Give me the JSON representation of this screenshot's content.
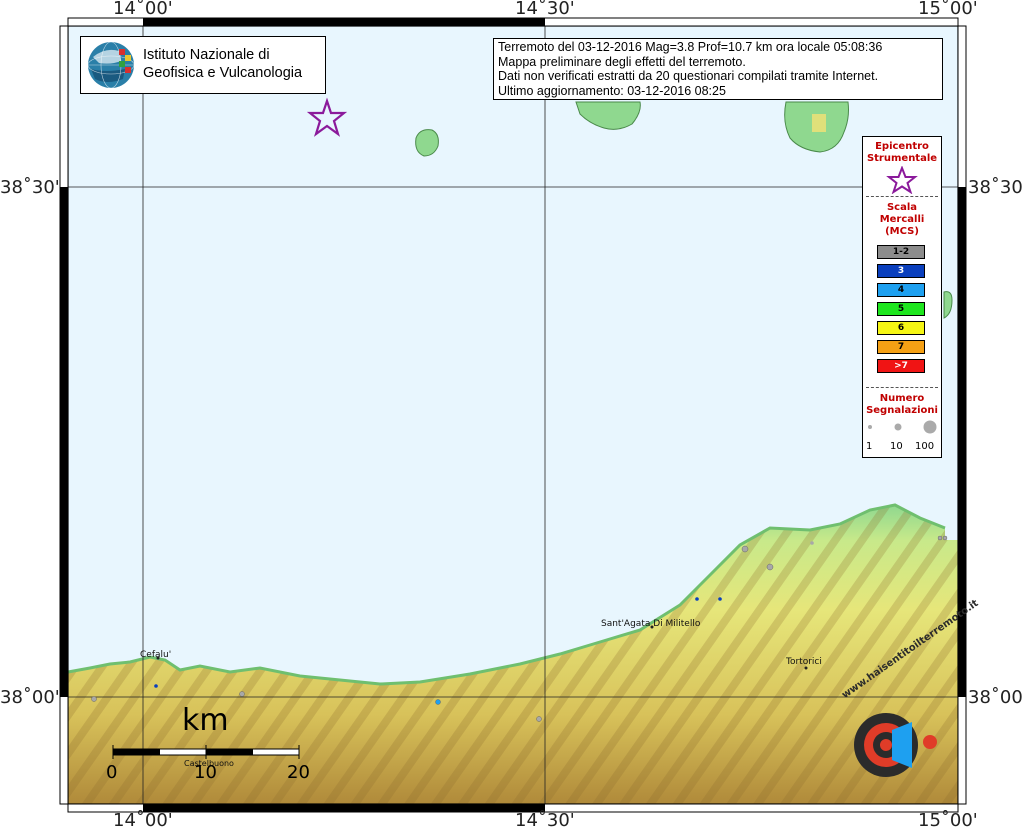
{
  "map": {
    "lon_labels": [
      "14˚00'",
      "14˚30'",
      "15˚00'"
    ],
    "lat_labels": [
      "38˚30'",
      "38˚00'"
    ],
    "colors": {
      "sea": "#e8f6fe",
      "frame": "#000000",
      "epicenter": "#8b1a9b"
    }
  },
  "institute": {
    "name_line1": "Istituto Nazionale di",
    "name_line2": "Geofisica e Vulcanologia"
  },
  "info": {
    "line1": "Terremoto del 03-12-2016 Mag=3.8 Prof=10.7 km ora locale 05:08:36",
    "line2": "Mappa preliminare degli effetti del terremoto.",
    "line3": "Dati non verificati estratti da 20 questionari compilati tramite Internet.",
    "line4": "Ultimo aggiornamento: 03-12-2016 08:25"
  },
  "legend": {
    "epicenter_title_1": "Epicentro",
    "epicenter_title_2": "Strumentale",
    "scale_title_1": "Scala",
    "scale_title_2": "Mercalli",
    "scale_title_3": "(MCS)",
    "classes": [
      {
        "label": "1-2",
        "color": "#8c8c8c",
        "text_color": "#000000"
      },
      {
        "label": "3",
        "color": "#0a3fbd",
        "text_color": "#ffffff"
      },
      {
        "label": "4",
        "color": "#1ea0f0",
        "text_color": "#000000"
      },
      {
        "label": "5",
        "color": "#1ee61e",
        "text_color": "#000000"
      },
      {
        "label": "6",
        "color": "#f5f514",
        "text_color": "#000000"
      },
      {
        "label": "7",
        "color": "#f5a014",
        "text_color": "#000000"
      },
      {
        "label": ">7",
        "color": "#f01414",
        "text_color": "#ffffff"
      }
    ],
    "count_title_1": "Numero",
    "count_title_2": "Segnalazioni",
    "count_values": [
      "1",
      "10",
      "100"
    ]
  },
  "towns": {
    "cefalu": "Cefalu'",
    "santagata": "Sant'Agata Di Militello",
    "tortorici": "Tortorici",
    "castelbuono": "Castelbuono"
  },
  "scale_bar": {
    "unit": "km",
    "ticks": [
      "0",
      "10",
      "20"
    ]
  },
  "brand": {
    "text": "www.haisentitoilterremoto.it"
  }
}
